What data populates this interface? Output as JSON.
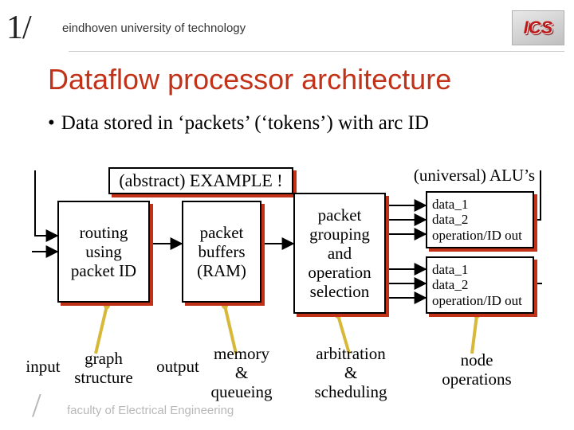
{
  "header": {
    "logo_left": "1/",
    "university": "eindhoven university of technology",
    "logo_right": "ICS"
  },
  "title": "Dataflow processor architecture",
  "bullet": "Data stored in ‘packets’ (‘tokens’) with arc ID",
  "blocks": {
    "example": "(abstract) EXAMPLE !",
    "routing": "routing\nusing\npacket ID",
    "buffers": "packet\nbuffers\n(RAM)",
    "grouping": "packet\ngrouping\nand\noperation\nselection",
    "alu_label": "(universal) ALU’s",
    "alu1": "data_1\ndata_2\noperation/ID out",
    "alu2": "data_1\ndata_2\noperation/ID out"
  },
  "labels": {
    "input": "input",
    "graph": "graph\nstructure",
    "output": "output",
    "memory": "memory\n&\nqueueing",
    "arb": "arbitration\n&\nscheduling",
    "node": "node\noperations"
  },
  "footer": {
    "slash": "/",
    "text": "faculty of Electrical Engineering"
  }
}
